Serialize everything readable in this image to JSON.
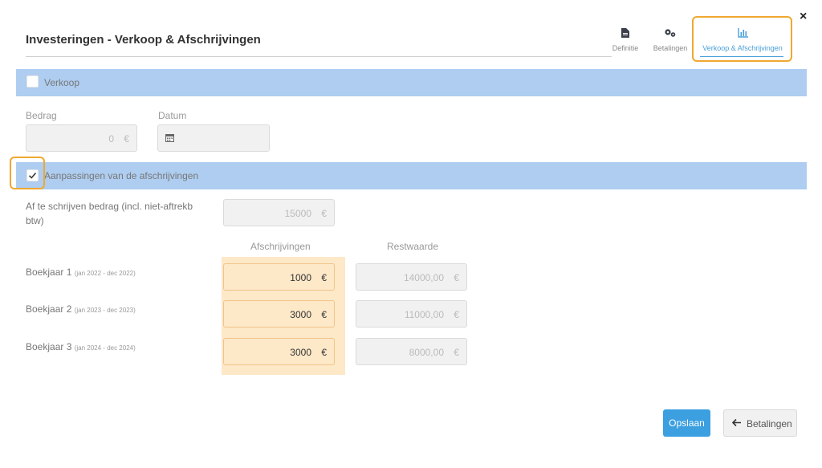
{
  "window": {
    "close_label": "×",
    "title": "Investeringen - Verkoop & Afschrijvingen"
  },
  "tabs": [
    {
      "label": "Definitie",
      "icon": "file-icon",
      "active": false
    },
    {
      "label": "Betalingen",
      "icon": "gears-icon",
      "active": false
    },
    {
      "label": "Verkoop & Afschrijvingen",
      "icon": "bar-chart-icon",
      "active": true
    }
  ],
  "colors": {
    "accent": "#3b9fe0",
    "band": "#aecdf0",
    "highlight": "#f0a830",
    "orange_fill": "#fde8c8"
  },
  "verkoop": {
    "checkbox_label": "Verkoop",
    "checked": false,
    "bedrag_label": "Bedrag",
    "bedrag_value": "0",
    "currency": "€",
    "datum_label": "Datum",
    "datum_value": ""
  },
  "aanpassingen": {
    "checkbox_label": "Aanpassingen van de afschrijvingen",
    "checked": true,
    "af_te_schrijven_label_1": "Af te schrijven bedrag (incl. niet-aftrekb",
    "af_te_schrijven_label_2": "btw)",
    "af_te_schrijven_value": "15000",
    "col_afschrijvingen": "Afschrijvingen",
    "col_restwaarde": "Restwaarde",
    "rows": [
      {
        "label": "Boekjaar 1",
        "period": "(jan 2022 - dec 2022)",
        "afschrijving": "1000",
        "restwaarde": "14000,00"
      },
      {
        "label": "Boekjaar 2",
        "period": "(jan 2023 - dec 2023)",
        "afschrijving": "3000",
        "restwaarde": "11000,00"
      },
      {
        "label": "Boekjaar 3",
        "period": "(jan 2024 - dec 2024)",
        "afschrijving": "3000",
        "restwaarde": "8000,00"
      }
    ]
  },
  "footer": {
    "save_label": "Opslaan",
    "back_label": "Betalingen"
  }
}
